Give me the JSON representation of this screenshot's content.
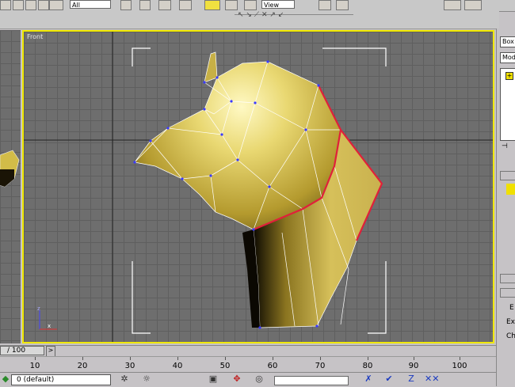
{
  "toolbar": {
    "filter_value": "All",
    "reference_value": "View"
  },
  "viewport": {
    "label": "Front"
  },
  "command_panel": {
    "object_name": "Box",
    "modifier_list": "Mod",
    "rollout_labels": [
      "E",
      "Ex",
      "Ch"
    ]
  },
  "timeline": {
    "slider_label": "/ 100"
  },
  "ruler": {
    "ticks": [
      "10",
      "20",
      "30",
      "40",
      "50",
      "60",
      "70",
      "80",
      "90",
      "100"
    ]
  },
  "status": {
    "layer_value": "0 (default)"
  },
  "colors": {
    "viewport_border": "#f0e800",
    "mesh_fill": "#d8c252",
    "edge_highlight": "#e0203a",
    "grid_bg": "#6e6e6e"
  }
}
